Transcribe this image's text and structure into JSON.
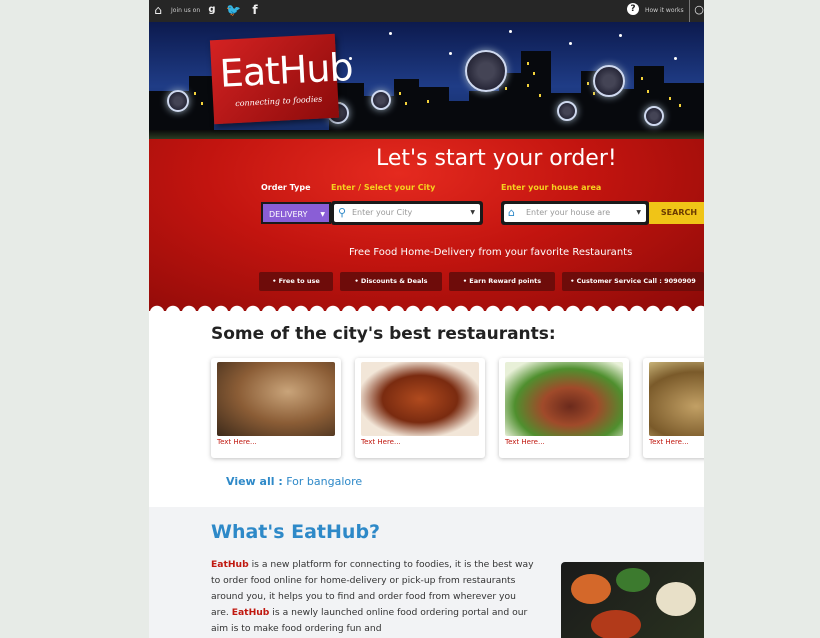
{
  "topbar": {
    "join_text": "Join us on",
    "how_text": "How it works"
  },
  "hero": {
    "logo_text": "EatHub",
    "logo_sub": "connecting to foodies"
  },
  "order": {
    "headline": "Let's start your order!",
    "order_type_label": "Order Type",
    "city_label": "Enter / Select your City",
    "area_label": "Enter your house area",
    "order_type_value": "DELIVERY",
    "city_placeholder": "Enter your City",
    "area_placeholder": "Enter your house are",
    "search_label": "SEARCH",
    "tagline": "Free Food Home-Delivery from your favorite Restaurants",
    "features": [
      "• Free to use",
      "• Discounts & Deals",
      "• Earn Reward points",
      "• Customer Service Call : 9090909"
    ]
  },
  "restaurants": {
    "title": "Some of the city's best restaurants:",
    "cards": [
      "Text Here...",
      "Text Here...",
      "Text Here...",
      "Text Here..."
    ],
    "view_all_label": "View all :",
    "view_all_city": "For bangalore"
  },
  "about": {
    "title": "What's EatHub?",
    "brand": "EatHub",
    "p1": " is a new platform for connecting to foodies, it is the best way to order food online for home-delivery or pick-up from restaurants around you, it helps you to find and order food from wherever you are. ",
    "brand2": "EatHub",
    "p2": " is a newly launched online food ordering portal and our aim is to make food ordering fun and"
  },
  "colors": {
    "accent_blue": "#2e89c8",
    "brand_red": "#c0180f",
    "search_yellow": "#f0c417",
    "delivery_purple": "#8a5ed6"
  }
}
